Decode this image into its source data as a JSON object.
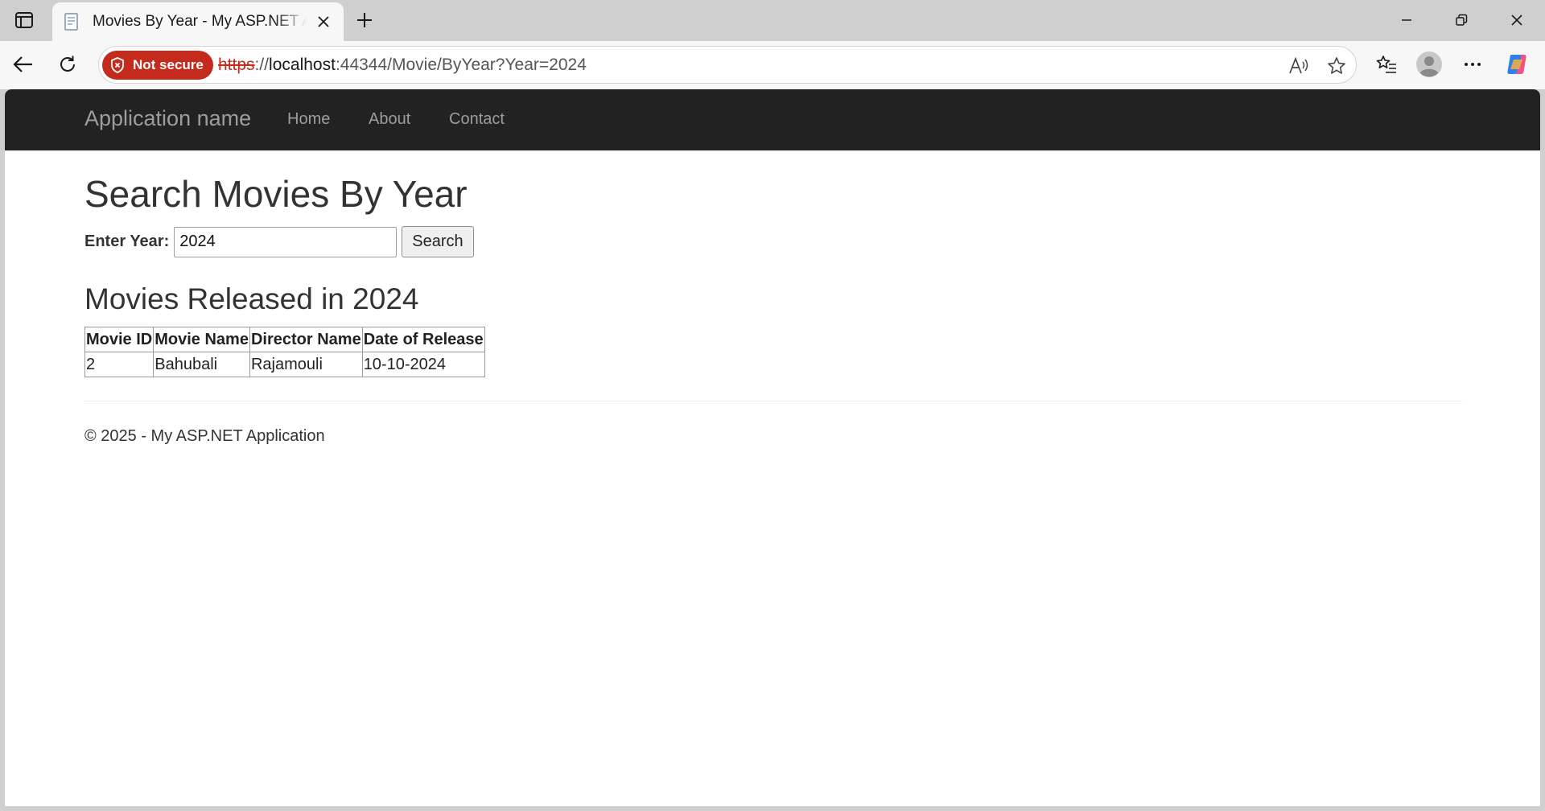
{
  "browser": {
    "tab_title": "Movies By Year - My ASP.NET Application",
    "security_label": "Not secure",
    "url_protocol": "https",
    "url_separator": "://",
    "url_host": "localhost",
    "url_rest": ":44344/Movie/ByYear?Year=2024"
  },
  "navbar": {
    "brand": "Application name",
    "links": [
      "Home",
      "About",
      "Contact"
    ]
  },
  "page": {
    "heading": "Search Movies By Year",
    "year_label": "Enter Year:",
    "year_value": "2024",
    "search_button": "Search",
    "results_heading": "Movies Released in 2024"
  },
  "table": {
    "headers": [
      "Movie ID",
      "Movie Name",
      "Director Name",
      "Date of Release"
    ],
    "rows": [
      [
        "2",
        "Bahubali",
        "Rajamouli",
        "10-10-2024"
      ]
    ]
  },
  "footer": {
    "text": "© 2025 - My ASP.NET Application"
  },
  "colors": {
    "navbar_bg": "#222222",
    "nav_text": "#9d9d9d",
    "not_secure_bg": "#c42b1c"
  }
}
